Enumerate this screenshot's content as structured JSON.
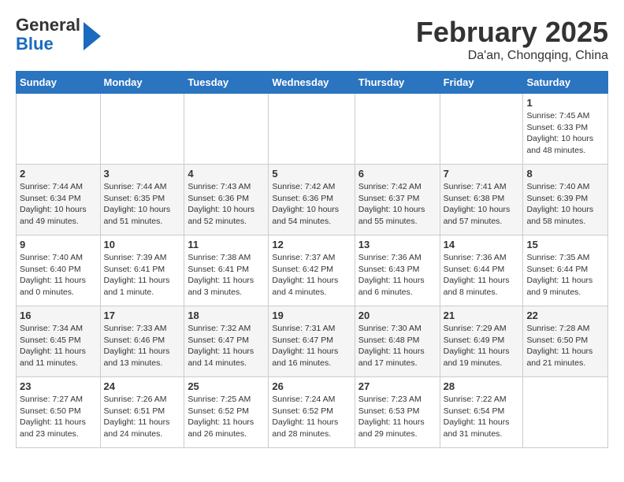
{
  "logo": {
    "general": "General",
    "blue": "Blue"
  },
  "title": "February 2025",
  "subtitle": "Da'an, Chongqing, China",
  "weekdays": [
    "Sunday",
    "Monday",
    "Tuesday",
    "Wednesday",
    "Thursday",
    "Friday",
    "Saturday"
  ],
  "weeks": [
    [
      {
        "day": "",
        "info": ""
      },
      {
        "day": "",
        "info": ""
      },
      {
        "day": "",
        "info": ""
      },
      {
        "day": "",
        "info": ""
      },
      {
        "day": "",
        "info": ""
      },
      {
        "day": "",
        "info": ""
      },
      {
        "day": "1",
        "info": "Sunrise: 7:45 AM\nSunset: 6:33 PM\nDaylight: 10 hours\nand 48 minutes."
      }
    ],
    [
      {
        "day": "2",
        "info": "Sunrise: 7:44 AM\nSunset: 6:34 PM\nDaylight: 10 hours\nand 49 minutes."
      },
      {
        "day": "3",
        "info": "Sunrise: 7:44 AM\nSunset: 6:35 PM\nDaylight: 10 hours\nand 51 minutes."
      },
      {
        "day": "4",
        "info": "Sunrise: 7:43 AM\nSunset: 6:36 PM\nDaylight: 10 hours\nand 52 minutes."
      },
      {
        "day": "5",
        "info": "Sunrise: 7:42 AM\nSunset: 6:36 PM\nDaylight: 10 hours\nand 54 minutes."
      },
      {
        "day": "6",
        "info": "Sunrise: 7:42 AM\nSunset: 6:37 PM\nDaylight: 10 hours\nand 55 minutes."
      },
      {
        "day": "7",
        "info": "Sunrise: 7:41 AM\nSunset: 6:38 PM\nDaylight: 10 hours\nand 57 minutes."
      },
      {
        "day": "8",
        "info": "Sunrise: 7:40 AM\nSunset: 6:39 PM\nDaylight: 10 hours\nand 58 minutes."
      }
    ],
    [
      {
        "day": "9",
        "info": "Sunrise: 7:40 AM\nSunset: 6:40 PM\nDaylight: 11 hours\nand 0 minutes."
      },
      {
        "day": "10",
        "info": "Sunrise: 7:39 AM\nSunset: 6:41 PM\nDaylight: 11 hours\nand 1 minute."
      },
      {
        "day": "11",
        "info": "Sunrise: 7:38 AM\nSunset: 6:41 PM\nDaylight: 11 hours\nand 3 minutes."
      },
      {
        "day": "12",
        "info": "Sunrise: 7:37 AM\nSunset: 6:42 PM\nDaylight: 11 hours\nand 4 minutes."
      },
      {
        "day": "13",
        "info": "Sunrise: 7:36 AM\nSunset: 6:43 PM\nDaylight: 11 hours\nand 6 minutes."
      },
      {
        "day": "14",
        "info": "Sunrise: 7:36 AM\nSunset: 6:44 PM\nDaylight: 11 hours\nand 8 minutes."
      },
      {
        "day": "15",
        "info": "Sunrise: 7:35 AM\nSunset: 6:44 PM\nDaylight: 11 hours\nand 9 minutes."
      }
    ],
    [
      {
        "day": "16",
        "info": "Sunrise: 7:34 AM\nSunset: 6:45 PM\nDaylight: 11 hours\nand 11 minutes."
      },
      {
        "day": "17",
        "info": "Sunrise: 7:33 AM\nSunset: 6:46 PM\nDaylight: 11 hours\nand 13 minutes."
      },
      {
        "day": "18",
        "info": "Sunrise: 7:32 AM\nSunset: 6:47 PM\nDaylight: 11 hours\nand 14 minutes."
      },
      {
        "day": "19",
        "info": "Sunrise: 7:31 AM\nSunset: 6:47 PM\nDaylight: 11 hours\nand 16 minutes."
      },
      {
        "day": "20",
        "info": "Sunrise: 7:30 AM\nSunset: 6:48 PM\nDaylight: 11 hours\nand 17 minutes."
      },
      {
        "day": "21",
        "info": "Sunrise: 7:29 AM\nSunset: 6:49 PM\nDaylight: 11 hours\nand 19 minutes."
      },
      {
        "day": "22",
        "info": "Sunrise: 7:28 AM\nSunset: 6:50 PM\nDaylight: 11 hours\nand 21 minutes."
      }
    ],
    [
      {
        "day": "23",
        "info": "Sunrise: 7:27 AM\nSunset: 6:50 PM\nDaylight: 11 hours\nand 23 minutes."
      },
      {
        "day": "24",
        "info": "Sunrise: 7:26 AM\nSunset: 6:51 PM\nDaylight: 11 hours\nand 24 minutes."
      },
      {
        "day": "25",
        "info": "Sunrise: 7:25 AM\nSunset: 6:52 PM\nDaylight: 11 hours\nand 26 minutes."
      },
      {
        "day": "26",
        "info": "Sunrise: 7:24 AM\nSunset: 6:52 PM\nDaylight: 11 hours\nand 28 minutes."
      },
      {
        "day": "27",
        "info": "Sunrise: 7:23 AM\nSunset: 6:53 PM\nDaylight: 11 hours\nand 29 minutes."
      },
      {
        "day": "28",
        "info": "Sunrise: 7:22 AM\nSunset: 6:54 PM\nDaylight: 11 hours\nand 31 minutes."
      },
      {
        "day": "",
        "info": ""
      }
    ]
  ]
}
